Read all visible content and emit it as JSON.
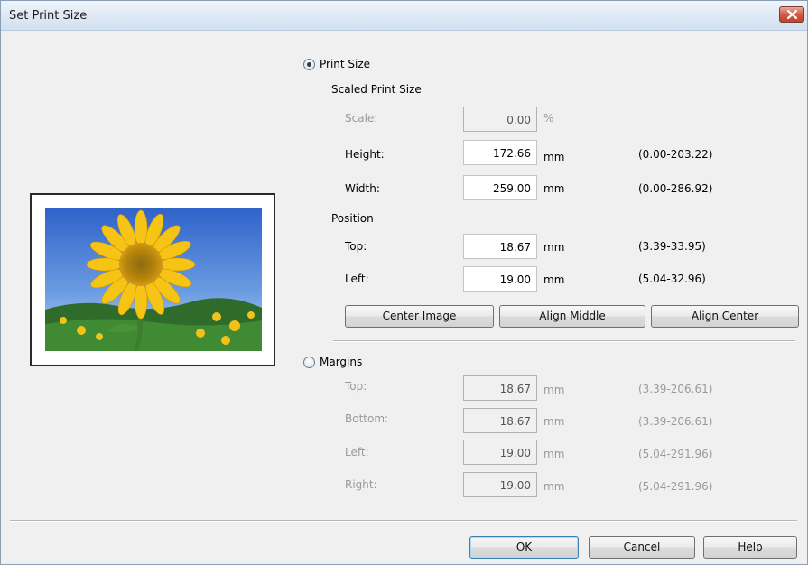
{
  "window": {
    "title": "Set Print Size"
  },
  "print_size": {
    "radio_label": "Print Size",
    "scaled_heading": "Scaled Print Size",
    "scale": {
      "label": "Scale:",
      "value": "0.00",
      "unit": "%"
    },
    "height": {
      "label": "Height:",
      "value": "172.66",
      "unit": "mm",
      "range": "(0.00-203.22)"
    },
    "width": {
      "label": "Width:",
      "value": "259.00",
      "unit": "mm",
      "range": "(0.00-286.92)"
    },
    "position_heading": "Position",
    "top": {
      "label": "Top:",
      "value": "18.67",
      "unit": "mm",
      "range": "(3.39-33.95)"
    },
    "left": {
      "label": "Left:",
      "value": "19.00",
      "unit": "mm",
      "range": "(5.04-32.96)"
    },
    "buttons": {
      "center_image": "Center Image",
      "align_middle": "Align Middle",
      "align_center": "Align Center"
    }
  },
  "margins": {
    "radio_label": "Margins",
    "top": {
      "label": "Top:",
      "value": "18.67",
      "unit": "mm",
      "range": "(3.39-206.61)"
    },
    "bottom": {
      "label": "Bottom:",
      "value": "18.67",
      "unit": "mm",
      "range": "(3.39-206.61)"
    },
    "left": {
      "label": "Left:",
      "value": "19.00",
      "unit": "mm",
      "range": "(5.04-291.96)"
    },
    "right": {
      "label": "Right:",
      "value": "19.00",
      "unit": "mm",
      "range": "(5.04-291.96)"
    }
  },
  "footer": {
    "ok": "OK",
    "cancel": "Cancel",
    "help": "Help"
  }
}
